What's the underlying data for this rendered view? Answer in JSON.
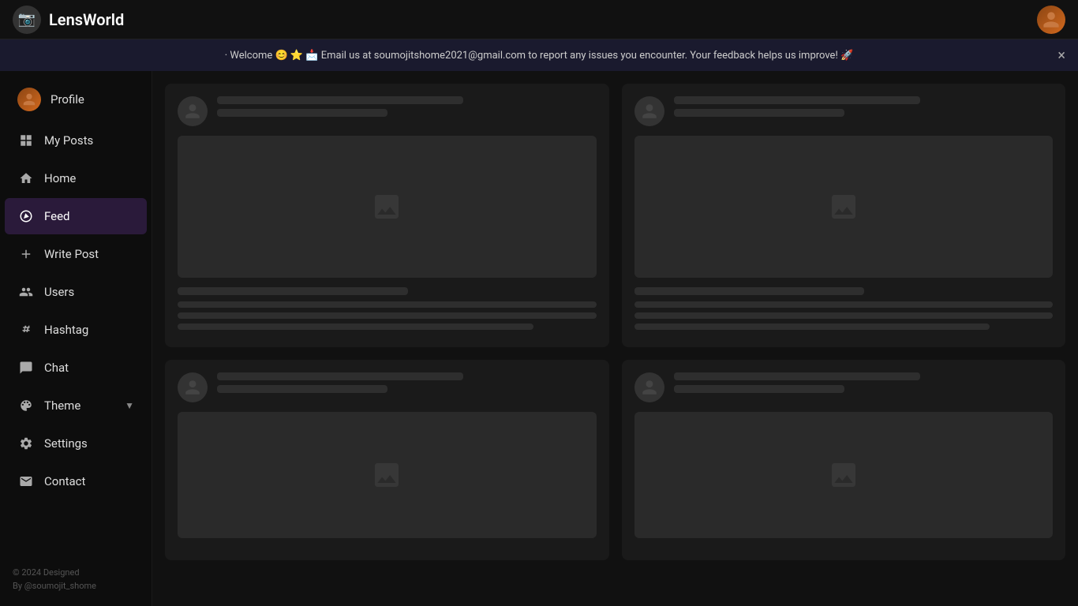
{
  "header": {
    "logo_emoji": "📷",
    "title": "LensWorld",
    "avatar_alt": "user avatar"
  },
  "banner": {
    "text": "· Welcome 😊 ⭐ 📩 Email us at soumojitshome2021@gmail.com to report any issues you encounter. Your feedback helps us improve! 🚀",
    "close_label": "×"
  },
  "sidebar": {
    "items": [
      {
        "id": "profile",
        "label": "Profile",
        "icon": "person"
      },
      {
        "id": "my-posts",
        "label": "My Posts",
        "icon": "grid"
      },
      {
        "id": "home",
        "label": "Home",
        "icon": "home"
      },
      {
        "id": "feed",
        "label": "Feed",
        "icon": "compass",
        "active": true
      },
      {
        "id": "write-post",
        "label": "Write Post",
        "icon": "plus"
      },
      {
        "id": "users",
        "label": "Users",
        "icon": "people"
      },
      {
        "id": "hashtag",
        "label": "Hashtag",
        "icon": "hash"
      },
      {
        "id": "chat",
        "label": "Chat",
        "icon": "chat"
      },
      {
        "id": "theme",
        "label": "Theme",
        "icon": "palette",
        "has_chevron": true
      },
      {
        "id": "settings",
        "label": "Settings",
        "icon": "gear"
      },
      {
        "id": "contact",
        "label": "Contact",
        "icon": "contact"
      }
    ],
    "footer_line1": "© 2024 Designed",
    "footer_line2": "By @soumojit_shome"
  },
  "posts": [
    {
      "id": 1,
      "position": "top-left"
    },
    {
      "id": 2,
      "position": "top-right"
    },
    {
      "id": 3,
      "position": "bottom-left"
    },
    {
      "id": 4,
      "position": "bottom-right"
    }
  ]
}
